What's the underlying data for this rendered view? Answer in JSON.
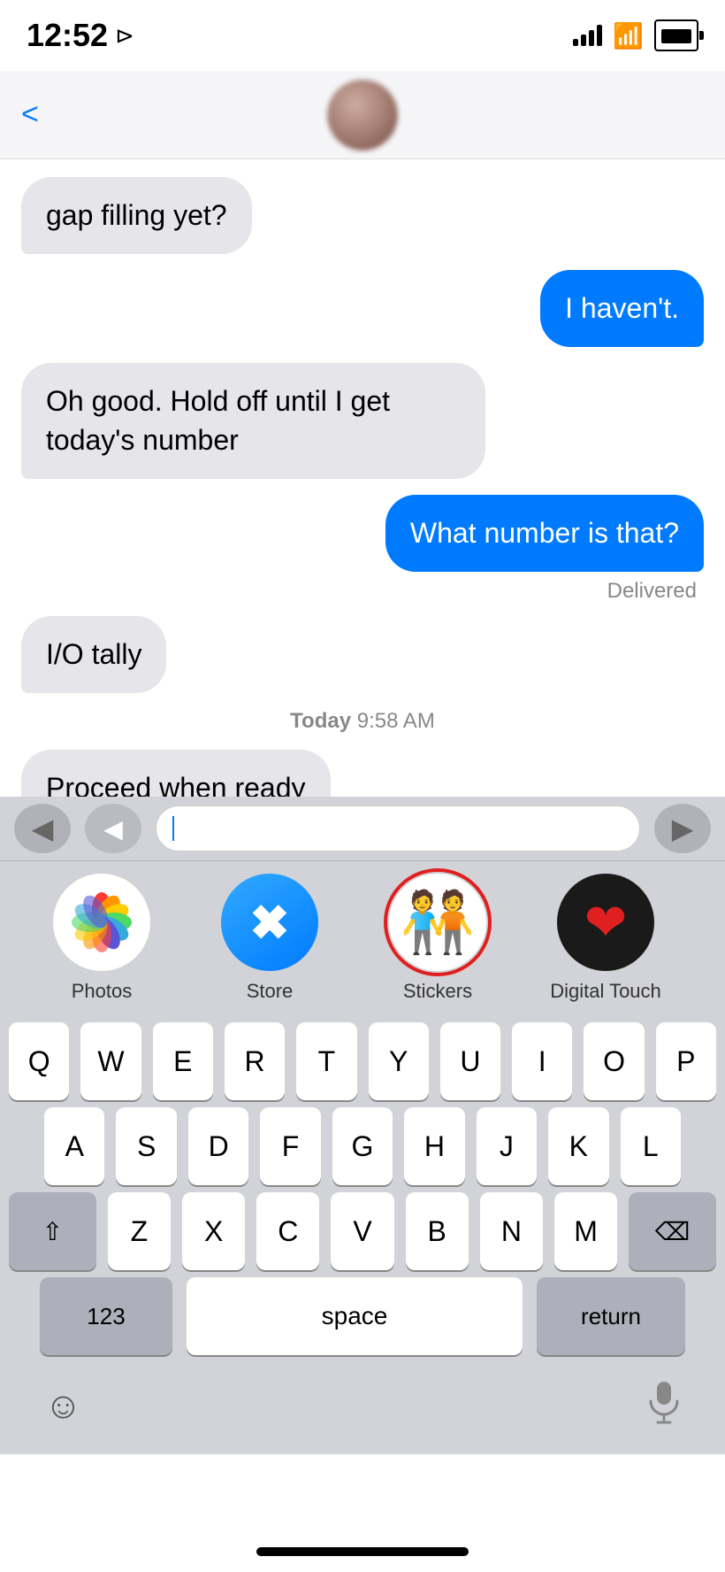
{
  "statusBar": {
    "time": "12:52",
    "locationIcon": "◂"
  },
  "navBar": {
    "backLabel": "<"
  },
  "messages": [
    {
      "id": "msg1",
      "type": "received",
      "text": "gap filling yet?"
    },
    {
      "id": "msg2",
      "type": "sent",
      "text": "I haven't."
    },
    {
      "id": "msg3",
      "type": "received",
      "text": "Oh good. Hold off until I get today's number"
    },
    {
      "id": "msg4",
      "type": "sent",
      "text": "What number is that?"
    },
    {
      "id": "msg-delivered",
      "type": "status",
      "text": "Delivered"
    },
    {
      "id": "msg5",
      "type": "received",
      "text": "I/O tally"
    },
    {
      "id": "msg-timestamp",
      "type": "timestamp",
      "text": "Today",
      "time": "9:58 AM"
    },
    {
      "id": "msg6",
      "type": "received",
      "text": "Proceed when ready"
    }
  ],
  "appDrawer": {
    "items": [
      {
        "id": "photos",
        "label": "Photos"
      },
      {
        "id": "store",
        "label": "Store"
      },
      {
        "id": "stickers",
        "label": "Stickers",
        "highlighted": true
      },
      {
        "id": "digital-touch",
        "label": "Digital Touch"
      }
    ]
  },
  "keyboard": {
    "rows": [
      [
        "Q",
        "W",
        "E",
        "R",
        "T",
        "Y",
        "U",
        "I",
        "O",
        "P"
      ],
      [
        "A",
        "S",
        "D",
        "F",
        "G",
        "H",
        "J",
        "K",
        "L"
      ],
      [
        "Z",
        "X",
        "C",
        "V",
        "B",
        "N",
        "M"
      ]
    ],
    "numbersLabel": "123",
    "spaceLabel": "space",
    "returnLabel": "return"
  },
  "bottomBar": {
    "emojiIcon": "☺",
    "micIcon": "🎤"
  }
}
